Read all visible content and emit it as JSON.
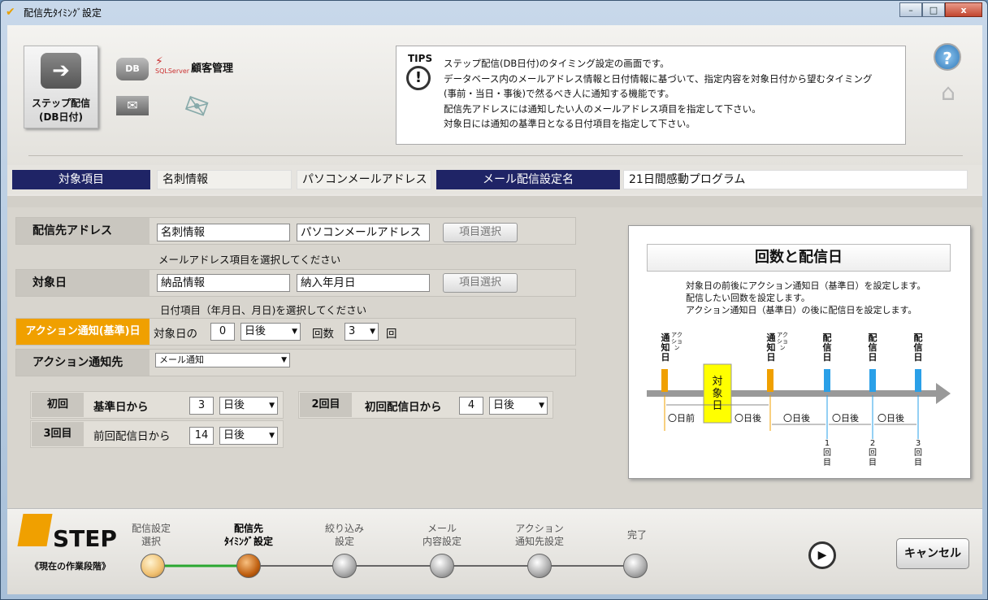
{
  "window": {
    "title": "配信先ﾀｲﾐﾝｸﾞ設定",
    "min": "–",
    "max": "□",
    "close": "x"
  },
  "header": {
    "step_button": [
      "ステップ配信",
      "(DB日付)"
    ],
    "db_label": "DB",
    "sql_label": "SQLServer",
    "customer_label": "顧客管理",
    "tips_title": "TIPS",
    "tips_text": "ステップ配信(DB日付)のタイミング設定の画面です。\nデータベース内のメールアドレス情報と日付情報に基づいて、指定内容を対象日付から望むタイミング\n(事前・当日・事後)で然るべき人に通知する機能です。\n配信先アドレスには通知したい人のメールアドレス項目を指定して下さい。\n対象日には通知の基準日となる日付項目を指定して下さい。"
  },
  "infobar": {
    "target_label": "対象項目",
    "target_table": "名刺情報",
    "target_field": "パソコンメールアドレス",
    "setting_label": "メール配信設定名",
    "setting_value": "21日間感動プログラム"
  },
  "form": {
    "addr_label": "配信先アドレス",
    "addr_table": "名刺情報",
    "addr_field": "パソコンメールアドレス",
    "select_btn": "項目選択",
    "addr_hint": "メールアドレス項目を選択してください",
    "date_label": "対象日",
    "date_table": "納品情報",
    "date_field": "納入年月日",
    "date_hint": "日付項目（年月日、月日)を選択してください",
    "action_label": "アクション通知(基準)日",
    "action_prefix": "対象日の",
    "action_days": "0",
    "action_when": "日後",
    "count_label": "回数",
    "count_value": "3",
    "count_unit": "回",
    "notify_label": "アクション通知先",
    "notify_value": "メール通知",
    "first_label": "初回",
    "first_text": "基準日から",
    "first_days": "3",
    "first_when": "日後",
    "second_label": "2回目",
    "second_text": "初回配信日から",
    "second_days": "4",
    "second_when": "日後",
    "third_label": "3回目",
    "third_text": "前回配信日から",
    "third_days": "14",
    "third_when": "日後"
  },
  "diagram": {
    "title": "回数と配信日",
    "desc": "対象日の前後にアクション通知日（基準日）を設定します。\n配信したい回数を設定します。\nアクション通知日（基準日）の後に配信日を設定します。",
    "notify": "通知日",
    "notify_small": "アクション",
    "deliver": "配信日",
    "target": "対象日",
    "before": "〇日前",
    "after": "〇日後",
    "n1": "1回目",
    "n2": "2回目",
    "n3": "3回目"
  },
  "footer": {
    "step": "STEP",
    "sub": "《現在の作業段階》",
    "steps": [
      "配信設定\n選択",
      "配信先\nﾀｲﾐﾝｸﾞ設定",
      "絞り込み\n設定",
      "メール\n内容設定",
      "アクション\n通知先設定",
      "完了"
    ],
    "cancel": "キャンセル"
  }
}
